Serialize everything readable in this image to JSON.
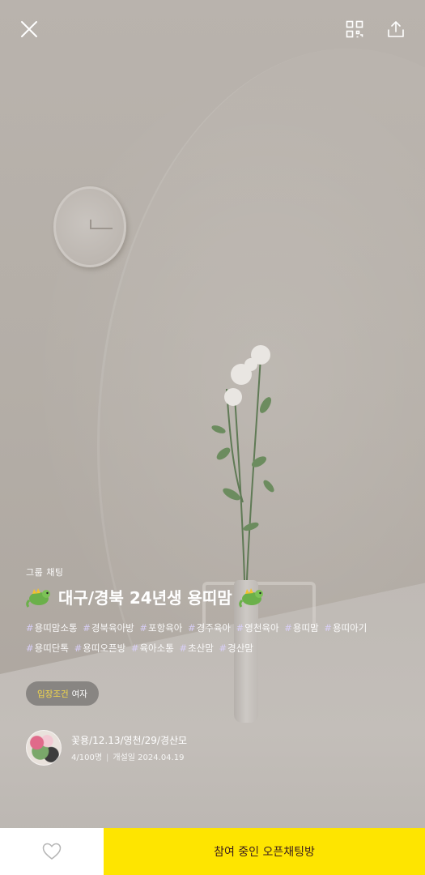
{
  "header": {
    "close_icon": "close-icon",
    "qr_icon": "qr-code-icon",
    "share_icon": "share-icon"
  },
  "chat": {
    "type_label": "그룹 채팅",
    "title": "대구/경북 24년생 용띠맘",
    "title_emoji": "dragon-icon",
    "tags": [
      "용띠맘소통",
      "경북육아방",
      "포항육아",
      "경주육아",
      "영천육아",
      "용띠맘",
      "용띠아기",
      "용띠단톡",
      "용띠오픈방",
      "육아소통",
      "초산맘",
      "경산맘"
    ],
    "entry_condition": {
      "label": "입장조건",
      "value": "여자"
    }
  },
  "host": {
    "name": "꽃용/12.13/영천/29/경산모",
    "members": "4/100명",
    "created": "개설일 2024.04.19"
  },
  "bottom_bar": {
    "like_icon": "heart-icon",
    "join_label": "참여 중인 오픈채팅방"
  },
  "colors": {
    "join_button": "#fee500",
    "entry_label": "#f5d949"
  }
}
